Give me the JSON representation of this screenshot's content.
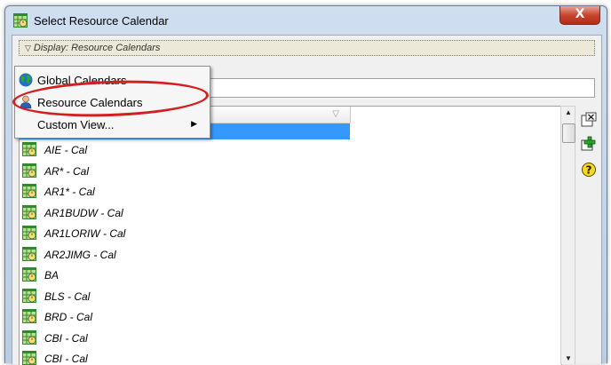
{
  "window": {
    "title": "Select Resource Calendar",
    "close_glyph": "X"
  },
  "display_bar": {
    "label": "Display: Resource Calendars"
  },
  "menu": {
    "items": [
      {
        "label": "Global Calendars",
        "icon": "globe-icon"
      },
      {
        "label": "Resource Calendars",
        "icon": "person-icon"
      },
      {
        "label": "Custom View...",
        "icon": "",
        "has_submenu": true
      }
    ]
  },
  "list": {
    "rows": [
      {
        "label": "AIE - Cal"
      },
      {
        "label": "AR* - Cal"
      },
      {
        "label": "AR1* - Cal"
      },
      {
        "label": "AR1BUDW - Cal"
      },
      {
        "label": "AR1LORIW - Cal"
      },
      {
        "label": "AR2JIMG - Cal"
      },
      {
        "label": "BA"
      },
      {
        "label": "BLS - Cal"
      },
      {
        "label": "BRD - Cal"
      },
      {
        "label": "CBI - Cal"
      },
      {
        "label": "CBI - Cal"
      }
    ]
  },
  "tools": [
    "close-panel-icon",
    "add-icon",
    "help-icon"
  ],
  "colors": {
    "selection": "#3399ff",
    "highlight_ellipse": "#d31f1f",
    "close_button": "#c7442e"
  }
}
